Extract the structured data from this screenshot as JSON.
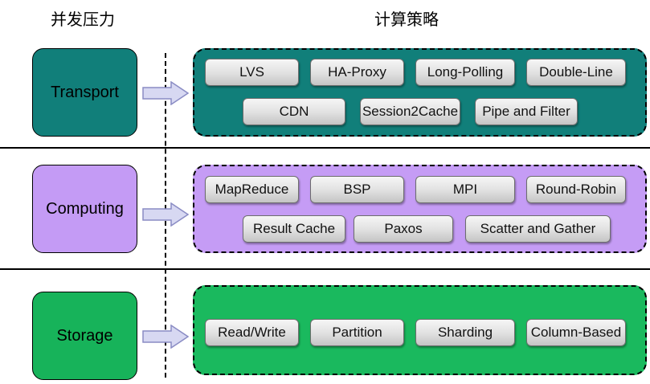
{
  "headings": {
    "left": "并发压力",
    "right": "计算策略"
  },
  "rows": [
    {
      "label": "Transport",
      "color": "#117f7a",
      "panel_color": "#117f7a",
      "pills": [
        "LVS",
        "HA-Proxy",
        "Long-Polling",
        "Double-Line",
        "CDN",
        "Session2Cache",
        "Pipe and Filter"
      ]
    },
    {
      "label": "Computing",
      "color": "#c49bf5",
      "panel_color": "#c59cf5",
      "pills": [
        "MapReduce",
        "BSP",
        "MPI",
        "Round-Robin",
        "Result Cache",
        "Paxos",
        "Scatter and Gather"
      ]
    },
    {
      "label": "Storage",
      "color": "#17b35a",
      "panel_color": "#1ab95e",
      "pills": [
        "Read/Write",
        "Partition",
        "Sharding",
        "Column-Based"
      ]
    }
  ],
  "arrow_color": "#d7d8f2",
  "arrow_border": "#8a8cc4"
}
